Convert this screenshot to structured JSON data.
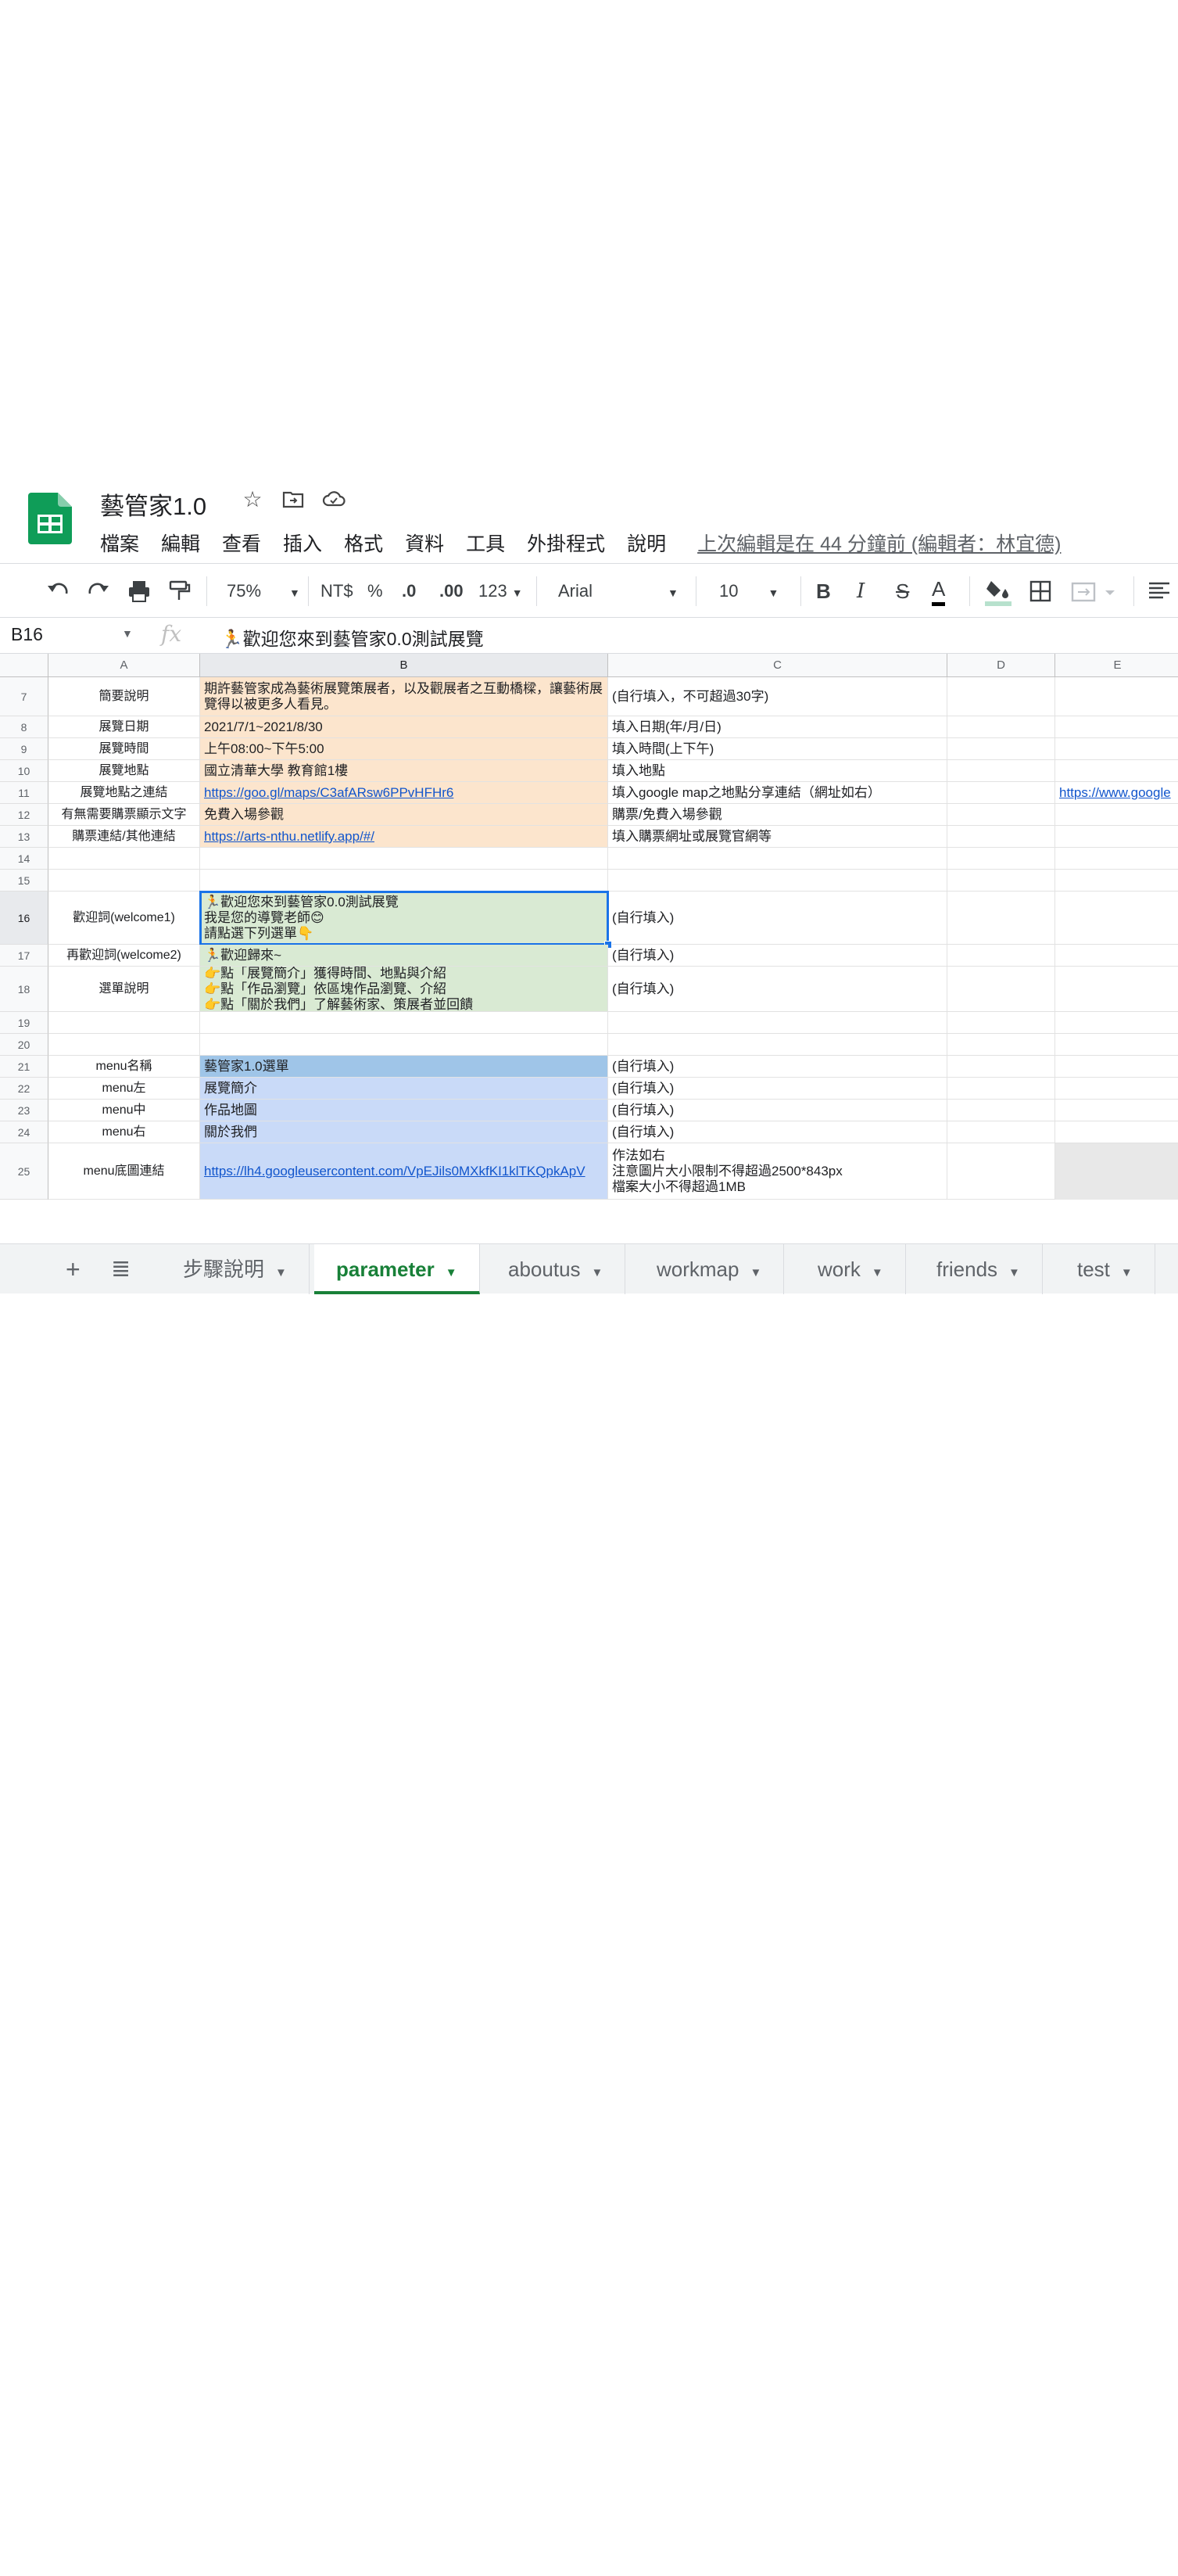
{
  "app": {
    "title": "藝管家1.0",
    "menu": [
      "檔案",
      "編輯",
      "查看",
      "插入",
      "格式",
      "資料",
      "工具",
      "外掛程式",
      "說明"
    ],
    "last_edit": "上次編輯是在 44 分鐘前 (編輯者：林宜德)"
  },
  "toolbar": {
    "zoom": "75%",
    "currency": "NT$",
    "percent": "%",
    "dec_decrease": ".0",
    "dec_increase": ".00",
    "format": "123",
    "font": "Arial",
    "font_size": "10",
    "bold": "B",
    "italic": "I",
    "strike": "S",
    "text_color": "A"
  },
  "formula_bar": {
    "cell_ref": "B16",
    "fx": "fx",
    "content": "歡迎您來到藝管家0.0測試展覽",
    "prefix_icon": "🏃"
  },
  "columns": [
    "A",
    "B",
    "C",
    "D",
    "E"
  ],
  "rows": [
    {
      "num": "7",
      "a": "簡要說明",
      "b": "期許藝管家成為藝術展覽策展者，以及觀展者之互動橋樑，讓藝術展覽得以被更多人看見。",
      "c": "(自行填入，不可超過30字)",
      "d": "",
      "e": ""
    },
    {
      "num": "8",
      "a": "展覽日期",
      "b": "2021/7/1~2021/8/30",
      "c": "填入日期(年/月/日)",
      "d": "",
      "e": ""
    },
    {
      "num": "9",
      "a": "展覽時間",
      "b": "上午08:00~下午5:00",
      "c": "填入時間(上下午)",
      "d": "",
      "e": ""
    },
    {
      "num": "10",
      "a": "展覽地點",
      "b": "國立清華大學 教育館1樓",
      "c": "填入地點",
      "d": "",
      "e": ""
    },
    {
      "num": "11",
      "a": "展覽地點之連結",
      "b": "https://goo.gl/maps/C3afARsw6PPvHFHr6",
      "c": "填入google map之地點分享連結（網址如右）",
      "d": "",
      "e": "https://www.google"
    },
    {
      "num": "12",
      "a": "有無需要購票顯示文字",
      "b": "免費入場參觀",
      "c": "購票/免費入場參觀",
      "d": "",
      "e": ""
    },
    {
      "num": "13",
      "a": "購票連結/其他連結",
      "b": "https://arts-nthu.netlify.app/#/",
      "c": "填入購票網址或展覽官網等",
      "d": "",
      "e": ""
    },
    {
      "num": "14",
      "a": "",
      "b": "",
      "c": "",
      "d": "",
      "e": ""
    },
    {
      "num": "15",
      "a": "",
      "b": "",
      "c": "",
      "d": "",
      "e": ""
    },
    {
      "num": "16",
      "a": "歡迎詞(welcome1)",
      "b": "🏃歡迎您來到藝管家0.0測試展覽\n我是您的導覽老師😊\n請點選下列選單👇",
      "c": "(自行填入)",
      "d": "",
      "e": ""
    },
    {
      "num": "17",
      "a": "再歡迎詞(welcome2)",
      "b": "🏃歡迎歸來~",
      "c": "(自行填入)",
      "d": "",
      "e": ""
    },
    {
      "num": "18",
      "a": "選單說明",
      "b": "👉點「展覽簡介」獲得時間、地點與介紹\n👉點「作品瀏覽」依區塊作品瀏覽、介紹\n👉點「關於我們」了解藝術家、策展者並回饋",
      "c": "(自行填入)",
      "d": "",
      "e": ""
    },
    {
      "num": "19",
      "a": "",
      "b": "",
      "c": "",
      "d": "",
      "e": ""
    },
    {
      "num": "20",
      "a": "",
      "b": "",
      "c": "",
      "d": "",
      "e": ""
    },
    {
      "num": "21",
      "a": "menu名稱",
      "b": "藝管家1.0選單",
      "c": "(自行填入)",
      "d": "",
      "e": ""
    },
    {
      "num": "22",
      "a": "menu左",
      "b": "展覽簡介",
      "c": "(自行填入)",
      "d": "",
      "e": ""
    },
    {
      "num": "23",
      "a": "menu中",
      "b": "作品地圖",
      "c": "(自行填入)",
      "d": "",
      "e": ""
    },
    {
      "num": "24",
      "a": "menu右",
      "b": "關於我們",
      "c": "(自行填入)",
      "d": "",
      "e": ""
    },
    {
      "num": "25",
      "a": "menu底圖連結",
      "b": "https://lh4.googleusercontent.com/VpEJils0MXkfKI1klTKQpkApV",
      "c": "作法如右\n注意圖片大小限制不得超過2500*843px\n檔案大小不得超過1MB",
      "d": "",
      "e": ""
    }
  ],
  "sheet_tabs": [
    "步驟說明",
    "parameter",
    "aboutus",
    "workmap",
    "work",
    "friends",
    "test"
  ],
  "active_tab": "parameter",
  "colors": {
    "peach": "#fce5cd",
    "green": "#d9ead3",
    "blue_dark": "#9fc5e8",
    "blue_light": "#c9daf8",
    "selection": "#1a73e8",
    "active_tab": "#188038",
    "link": "#1155cc"
  }
}
